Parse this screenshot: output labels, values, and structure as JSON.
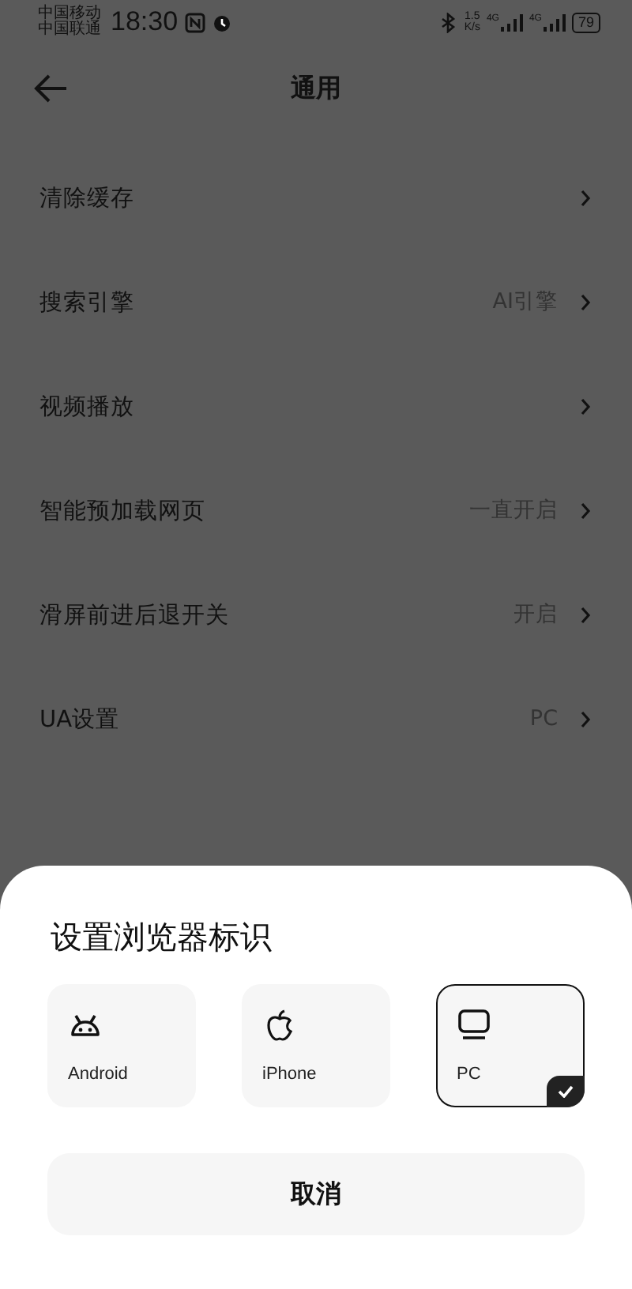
{
  "status_bar": {
    "carriers": [
      "中国移动",
      "中国联通"
    ],
    "time": "18:30",
    "speed": [
      "1.5",
      "K/s"
    ],
    "networks": [
      "4G",
      "4G"
    ],
    "battery": "79"
  },
  "header": {
    "title": "通用"
  },
  "settings": [
    {
      "label": "清除缓存"
    },
    {
      "label": "搜索引擎",
      "value": "AI引擎"
    },
    {
      "label": "视频播放"
    },
    {
      "label": "智能预加载网页",
      "value": "一直开启"
    },
    {
      "label": "滑屏前进后退开关",
      "value": "开启"
    },
    {
      "label": "UA设置",
      "value": "PC"
    }
  ],
  "sheet": {
    "title": "设置浏览器标识",
    "options": [
      {
        "kind": "android",
        "label": "Android",
        "selected": false
      },
      {
        "kind": "apple",
        "label": "iPhone",
        "selected": false
      },
      {
        "kind": "pc",
        "label": "PC",
        "selected": true
      }
    ],
    "cancel": "取消"
  }
}
